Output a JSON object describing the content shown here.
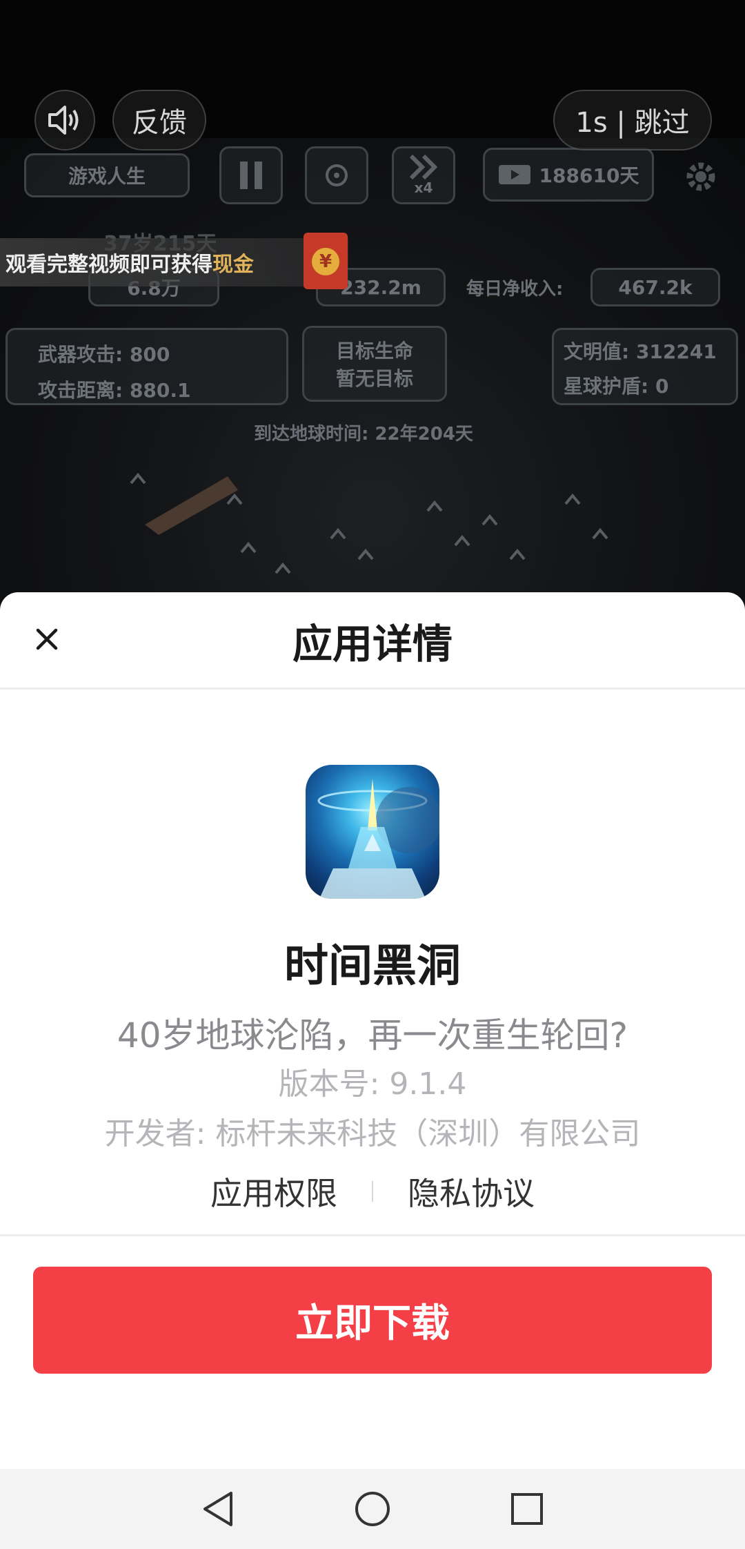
{
  "video": {
    "feedback_label": "反馈",
    "skip_label": "1s | 跳过",
    "hud": {
      "game_mode": "游戏人生",
      "speed_label": "x4",
      "days": "188610天",
      "age": "37岁215天",
      "score": "6.8万",
      "deposit": "232.2m",
      "daily_income_label": "每日净收入:",
      "daily_income": "467.2k",
      "weapon_attack": "武器攻击: 800",
      "attack_range": "攻击距离: 880.1",
      "target_label": "目标生命",
      "target_status": "暂无目标",
      "civilization": "文明值: 312241",
      "planet_shield": "星球护盾: 0",
      "arrival_time": "到达地球时间: 22年204天"
    },
    "reward_banner_prefix": "观看完整视频即可获得",
    "reward_banner_highlight": "现金",
    "red_packet_symbol": "¥"
  },
  "sheet": {
    "title": "应用详情",
    "app_name": "时间黑洞",
    "slogan": "40岁地球沦陷，再一次重生轮回?",
    "version": "版本号: 9.1.4",
    "developer": "开发者: 标杆未来科技（深圳）有限公司",
    "permissions_link": "应用权限",
    "privacy_link": "隐私协议",
    "download_label": "立即下载"
  },
  "colors": {
    "accent": "#f53f46",
    "sheet_bg": "#ffffff",
    "nav_bg": "#f3f3f3"
  },
  "icons": {
    "close": "close-icon",
    "sound": "speaker-icon",
    "back": "nav-back-icon",
    "home": "nav-home-icon",
    "recents": "nav-recents-icon"
  }
}
